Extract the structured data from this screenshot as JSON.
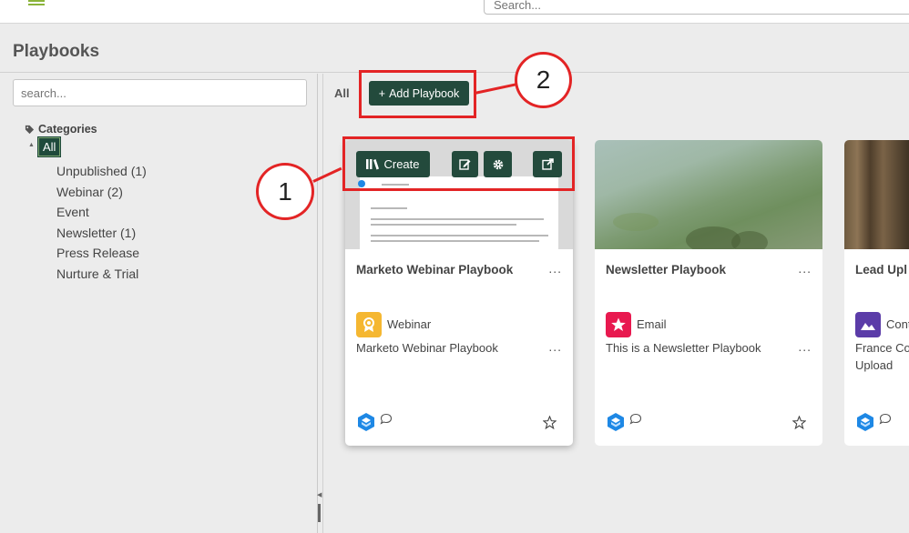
{
  "topbar": {
    "search_placeholder": "Search...",
    "menu_icon": "hamburger-icon"
  },
  "page": {
    "title": "Playbooks"
  },
  "sidebar": {
    "search_placeholder": "search...",
    "categories_label": "Categories",
    "all_label": "All",
    "items": [
      {
        "label": "Unpublished (1)"
      },
      {
        "label": "Webinar (2)"
      },
      {
        "label": "Event"
      },
      {
        "label": "Newsletter (1)"
      },
      {
        "label": "Press Release"
      },
      {
        "label": "Nurture & Trial"
      }
    ]
  },
  "main": {
    "filter_all": "All",
    "add_button": "Add Playbook",
    "add_icon": "+"
  },
  "card_toolbar": {
    "create_label": "Create"
  },
  "annotations": {
    "one": "1",
    "two": "2",
    "color": "#e32425"
  },
  "cards": [
    {
      "title": "Marketo Webinar Playbook",
      "category": "Webinar",
      "category_color": "#f5b731",
      "category_icon": "badge-icon",
      "description": "Marketo Webinar Playbook",
      "more": "..."
    },
    {
      "title": "Newsletter Playbook",
      "category": "Email",
      "category_color": "#e8194f",
      "category_icon": "star-icon",
      "description": "This is a Newsletter Playbook",
      "more": "..."
    },
    {
      "title": "Lead Upl",
      "category": "Cont",
      "category_color": "#5b3ca8",
      "category_icon": "image-icon",
      "description": "France Co Upload",
      "more": ""
    }
  ],
  "colors": {
    "button": "#234a3c",
    "accent": "#8bb43a"
  }
}
